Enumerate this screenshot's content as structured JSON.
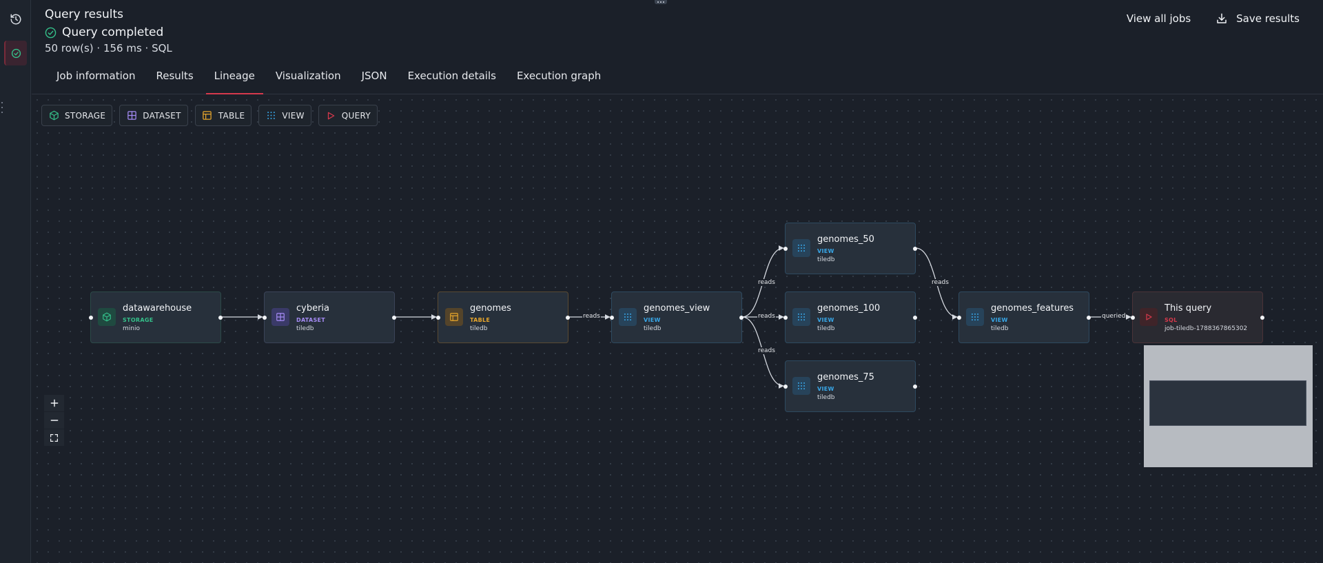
{
  "header": {
    "title": "Query results",
    "status": "Query completed",
    "meta": "50 row(s) · 156 ms · SQL",
    "actions": {
      "view_all": "View all jobs",
      "save": "Save results"
    }
  },
  "tabs": [
    {
      "label": "Job information"
    },
    {
      "label": "Results"
    },
    {
      "label": "Lineage",
      "active": true
    },
    {
      "label": "Visualization"
    },
    {
      "label": "JSON"
    },
    {
      "label": "Execution details"
    },
    {
      "label": "Execution graph"
    }
  ],
  "legend": [
    {
      "label": "STORAGE",
      "icon": "cube-icon",
      "color": "#34c08a"
    },
    {
      "label": "DATASET",
      "icon": "grid-icon",
      "color": "#a58bf5"
    },
    {
      "label": "TABLE",
      "icon": "table-icon",
      "color": "#e8a62b"
    },
    {
      "label": "VIEW",
      "icon": "dots-grid-icon",
      "color": "#38a7e8"
    },
    {
      "label": "QUERY",
      "icon": "play-icon",
      "color": "#d6394c"
    }
  ],
  "nodes": {
    "datawarehouse": {
      "name": "datawarehouse",
      "type": "STORAGE",
      "sub": "minio"
    },
    "cyberia": {
      "name": "cyberia",
      "type": "DATASET",
      "sub": "tiledb"
    },
    "genomes": {
      "name": "genomes",
      "type": "TABLE",
      "sub": "tiledb"
    },
    "genomes_view": {
      "name": "genomes_view",
      "type": "VIEW",
      "sub": "tiledb"
    },
    "genomes_50": {
      "name": "genomes_50",
      "type": "VIEW",
      "sub": "tiledb"
    },
    "genomes_100": {
      "name": "genomes_100",
      "type": "VIEW",
      "sub": "tiledb"
    },
    "genomes_75": {
      "name": "genomes_75",
      "type": "VIEW",
      "sub": "tiledb"
    },
    "genomes_features": {
      "name": "genomes_features",
      "type": "VIEW",
      "sub": "tiledb"
    },
    "this_query": {
      "name": "This query",
      "type": "SQL",
      "sub": "job-tiledb-1788367865302"
    }
  },
  "edge_labels": {
    "reads": "reads",
    "queried": "queried"
  }
}
